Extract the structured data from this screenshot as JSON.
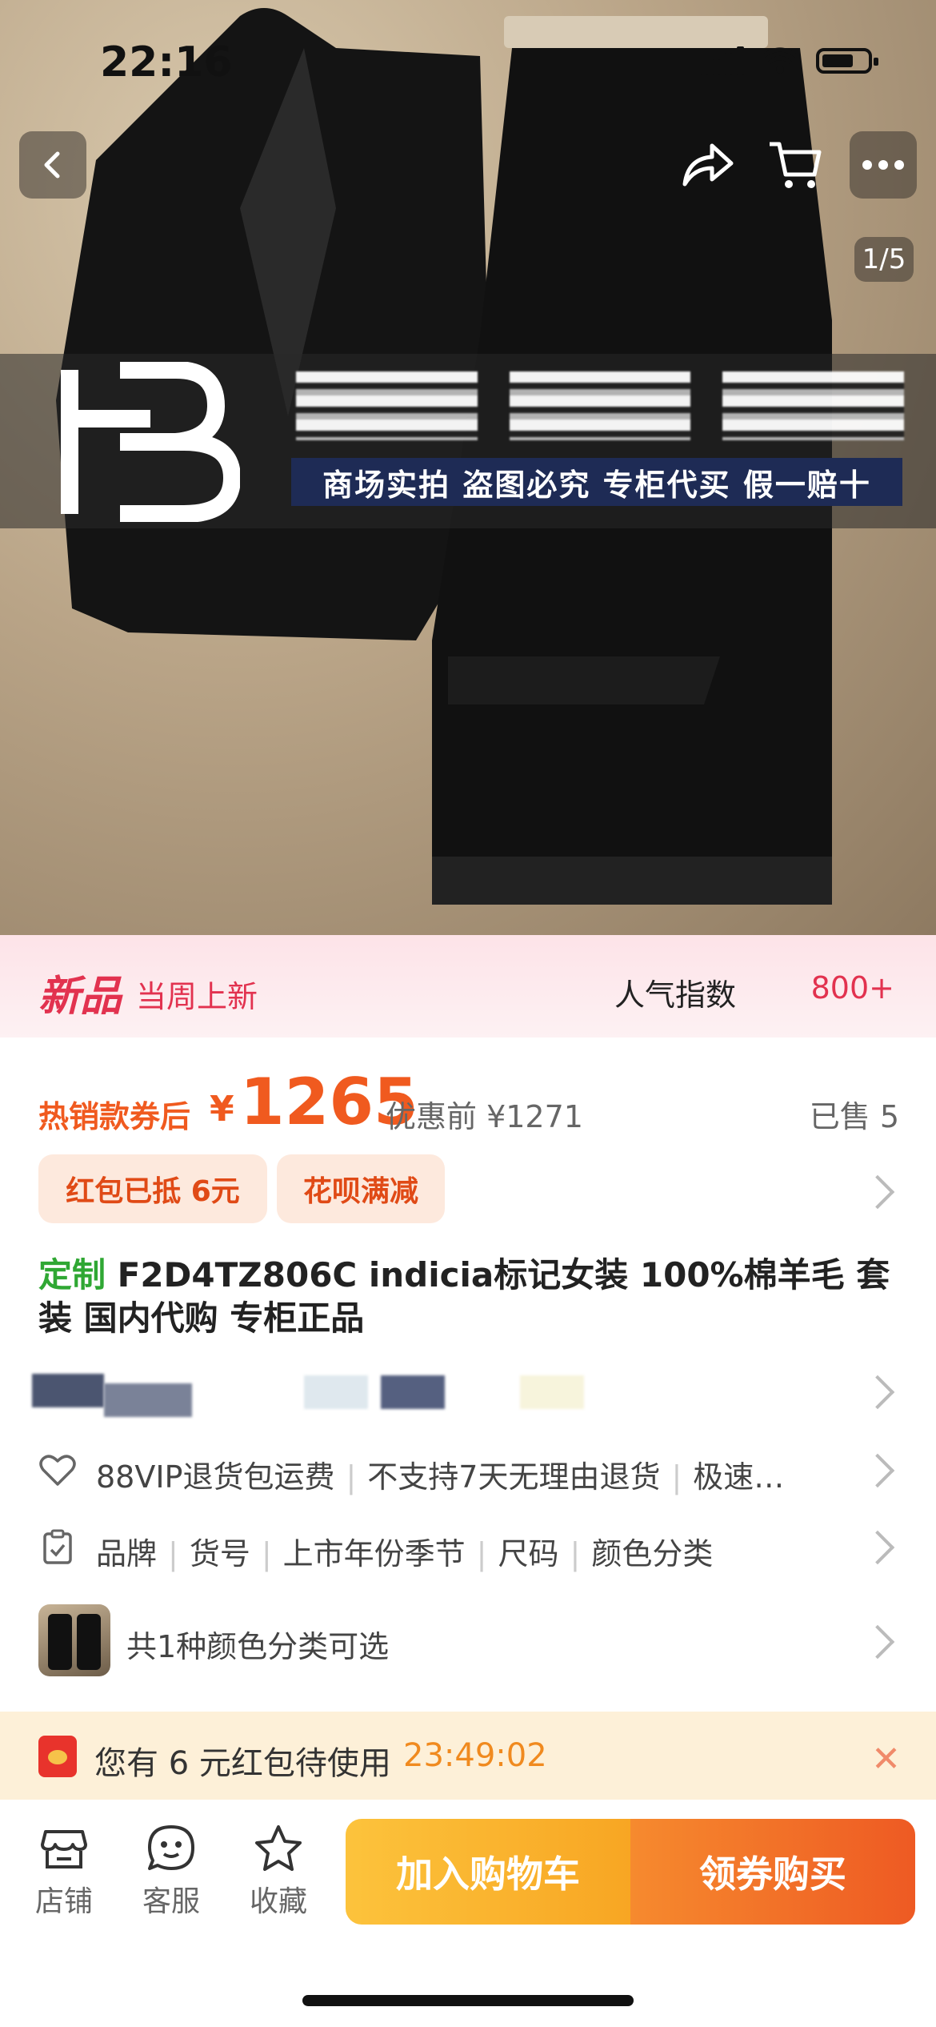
{
  "status_bar": {
    "time": "22:16"
  },
  "gallery": {
    "counter": "1/5"
  },
  "watermark": {
    "tagline": "商场实拍 盗图必究 专柜代买 假一赔十"
  },
  "new_banner": {
    "tag": "新品",
    "subtitle": "当周上新",
    "popularity_label": "人气指数",
    "popularity_value": "800+"
  },
  "price": {
    "coupon_label": "热销款券后",
    "currency": "¥",
    "amount": "1265",
    "before_label": "优惠前 ¥1271",
    "sold": "已售 5"
  },
  "chips": [
    "红包已抵 6元",
    "花呗满减"
  ],
  "product": {
    "tag": "定制",
    "title": "F2D4TZ806C indicia标记女装 100%棉羊毛 套装 国内代购 专柜正品"
  },
  "service_row": {
    "items": [
      "88VIP退货包运费",
      "不支持7天无理由退货",
      "极速…"
    ]
  },
  "params_row": {
    "items": [
      "品牌",
      "货号",
      "上市年份季节",
      "尺码",
      "颜色分类"
    ]
  },
  "color_row": {
    "text": "共1种颜色分类可选"
  },
  "packet_bar": {
    "text": "您有 6 元红包待使用",
    "countdown": "23:49:02",
    "close": "✕"
  },
  "bottom_bar": {
    "store": "店铺",
    "service": "客服",
    "favorite": "收藏",
    "add_to_cart": "加入购物车",
    "buy": "领券购买"
  },
  "colors": {
    "accent": "#f05a1f",
    "new_red": "#e2324f",
    "custom_green": "#2fa733"
  }
}
